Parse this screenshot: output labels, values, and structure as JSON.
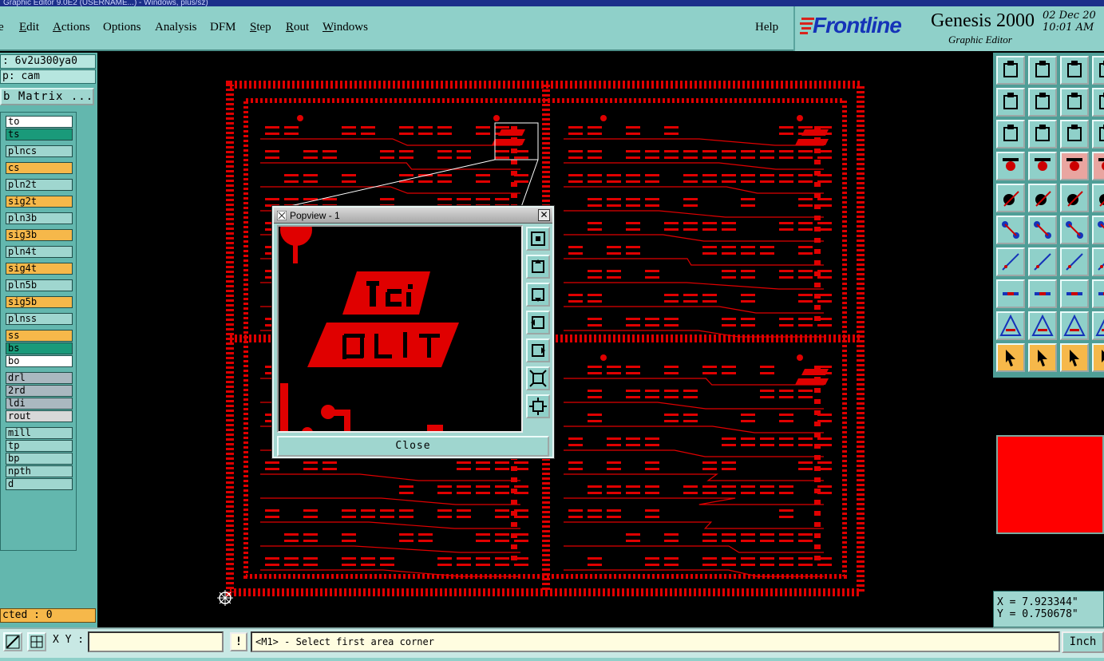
{
  "window": {
    "title": "Graphic Editor 9.0E2 (USERNAME...) - Windows, plus/sz)"
  },
  "menu": [
    {
      "label": "e",
      "accel": ""
    },
    {
      "label": "Edit",
      "accel": "E"
    },
    {
      "label": "Actions",
      "accel": "A"
    },
    {
      "label": "Options",
      "accel": ""
    },
    {
      "label": "Analysis",
      "accel": ""
    },
    {
      "label": "DFM",
      "accel": ""
    },
    {
      "label": "Step",
      "accel": "S"
    },
    {
      "label": "Rout",
      "accel": "R"
    },
    {
      "label": "Windows",
      "accel": "W"
    },
    {
      "label": "Help",
      "accel": ""
    }
  ],
  "brand": {
    "name": "Frontline",
    "product": "Genesis 2000",
    "subtitle": "Graphic Editor",
    "date_line1": "02 Dec 20",
    "date_line2": "10:01 AM"
  },
  "left": {
    "job": ": 6v2u300ya0",
    "step": "p: cam",
    "matrix_button": "b Matrix ...",
    "selected": "cted : 0",
    "layers": [
      {
        "name": "to",
        "color": "#ffffff"
      },
      {
        "name": "ts",
        "color": "#1a9a7a"
      },
      {
        "name": "plncs",
        "color": "#9fd6cf"
      },
      {
        "name": "cs",
        "color": "#f6b84a",
        "active": true
      },
      {
        "name": "pln2t",
        "color": "#9fd6cf"
      },
      {
        "name": "sig2t",
        "color": "#f6b84a"
      },
      {
        "name": "pln3b",
        "color": "#9fd6cf"
      },
      {
        "name": "sig3b",
        "color": "#f6b84a"
      },
      {
        "name": "pln4t",
        "color": "#9fd6cf"
      },
      {
        "name": "sig4t",
        "color": "#f6b84a"
      },
      {
        "name": "pln5b",
        "color": "#9fd6cf"
      },
      {
        "name": "sig5b",
        "color": "#f6b84a"
      },
      {
        "name": "plnss",
        "color": "#9fd6cf"
      },
      {
        "name": "ss",
        "color": "#f6b84a"
      },
      {
        "name": "bs",
        "color": "#1a9a7a"
      },
      {
        "name": "bo",
        "color": "#ffffff"
      },
      {
        "name": "drl",
        "color": "#aab8c0"
      },
      {
        "name": "2rd",
        "color": "#aab8c0"
      },
      {
        "name": "ldi",
        "color": "#aab8c0"
      },
      {
        "name": "rout",
        "color": "#d8d8d8"
      },
      {
        "name": "mill",
        "color": "#9fd6cf"
      },
      {
        "name": "tp",
        "color": "#9fd6cf"
      },
      {
        "name": "bp",
        "color": "#9fd6cf"
      },
      {
        "name": "npth",
        "color": "#9fd6cf"
      },
      {
        "name": "d",
        "color": "#9fd6cf"
      }
    ]
  },
  "popview": {
    "title": "Popview - 1",
    "close_label": "Close"
  },
  "coords": {
    "x": "X = 7.923344\"",
    "y": "Y = 0.750678\""
  },
  "status": {
    "xy_label": "X Y :",
    "xy_value": "",
    "message": "<M1> - Select first area corner",
    "units": "Inch"
  },
  "colors": {
    "accent": "#8fd0c9",
    "layer_draw": "#e00000",
    "brand_blue": "#1533b8"
  }
}
